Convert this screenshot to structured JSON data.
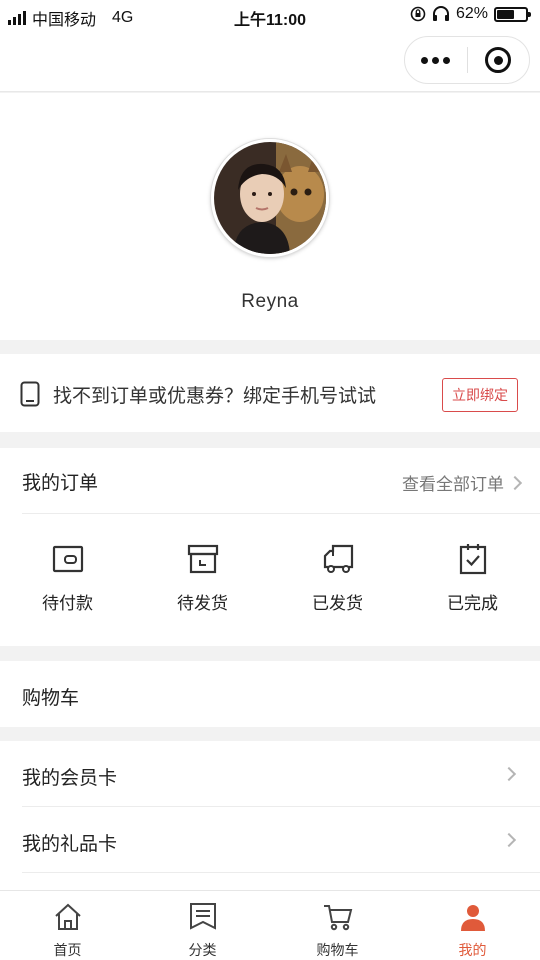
{
  "status_bar": {
    "carrier": "中国移动",
    "network": "4G",
    "time": "上午11:00",
    "battery_percent": "62%",
    "battery_level": 0.62
  },
  "capsule": {
    "more_icon": "more-dots-icon",
    "close_icon": "target-circle-icon"
  },
  "profile": {
    "username": "Reyna"
  },
  "bind_phone": {
    "text": "找不到订单或优惠券？绑定手机号试试",
    "button_label": "立即绑定",
    "accent_color": "#d94b4b"
  },
  "orders": {
    "title": "我的订单",
    "view_all": "查看全部订单",
    "statuses": [
      {
        "label": "待付款",
        "icon": "wallet-icon"
      },
      {
        "label": "待发货",
        "icon": "box-icon"
      },
      {
        "label": "已发货",
        "icon": "truck-icon"
      },
      {
        "label": "已完成",
        "icon": "clipboard-check-icon"
      }
    ]
  },
  "cart": {
    "title": "购物车"
  },
  "menu": {
    "items": [
      {
        "label": "我的会员卡"
      },
      {
        "label": "我的礼品卡"
      }
    ]
  },
  "tabbar": {
    "active_color": "#e05a3a",
    "tabs": [
      {
        "label": "首页",
        "icon": "home-icon"
      },
      {
        "label": "分类",
        "icon": "category-icon"
      },
      {
        "label": "购物车",
        "icon": "cart-icon"
      },
      {
        "label": "我的",
        "icon": "user-icon"
      }
    ]
  }
}
